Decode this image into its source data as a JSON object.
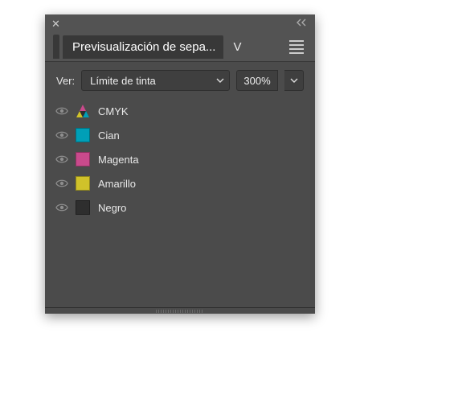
{
  "titlebar": {
    "close": "✕",
    "collapse": "<<"
  },
  "tabs": {
    "active_label": "Previsualización de sepa...",
    "inactive_hint": "V"
  },
  "controls": {
    "view_label": "Ver:",
    "mode_value": "Límite de tinta",
    "percent_value": "300%"
  },
  "channels": [
    {
      "name": "CMYK",
      "swatch": "cmyk",
      "visible": true
    },
    {
      "name": "Cian",
      "swatch": "#009fb7",
      "visible": true
    },
    {
      "name": "Magenta",
      "swatch": "#c94a8c",
      "visible": true
    },
    {
      "name": "Amarillo",
      "swatch": "#d0c22a",
      "visible": true
    },
    {
      "name": "Negro",
      "swatch": "#2e2e2e",
      "visible": true
    }
  ]
}
